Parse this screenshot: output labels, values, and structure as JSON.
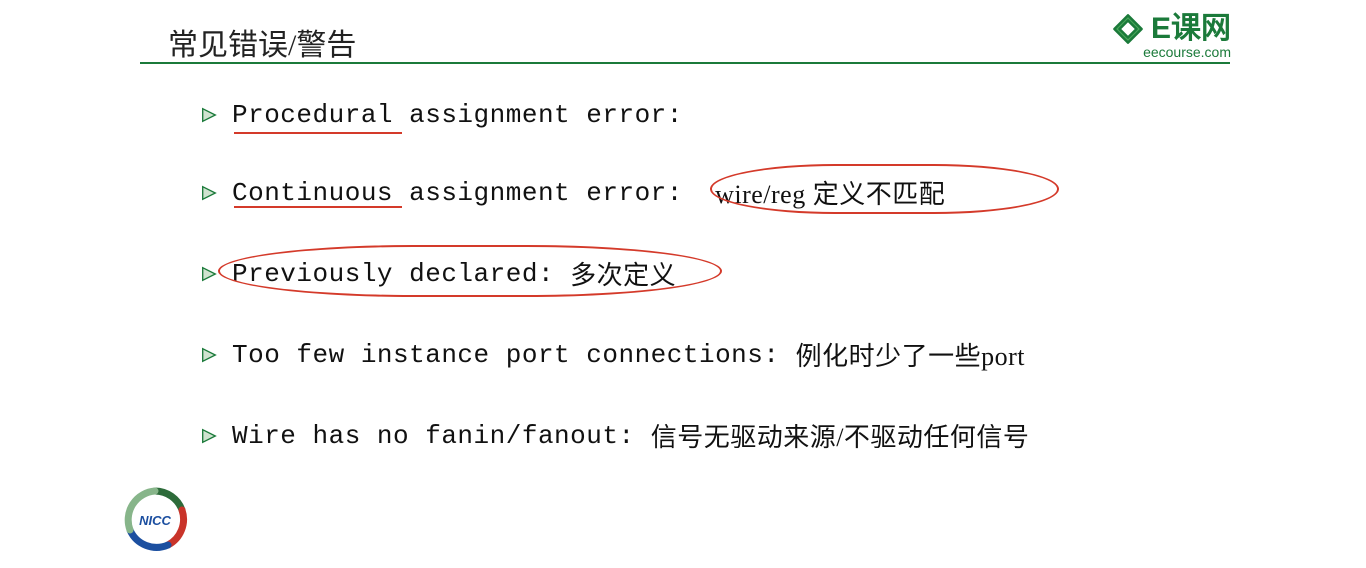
{
  "header": {
    "title": "常见错误/警告",
    "logo_text": "E课网",
    "logo_sub": "eecourse.com"
  },
  "bullets": {
    "b1_en": "Procedural assignment error:",
    "b2_en": "Continuous assignment error:",
    "b2_note": "wire/reg 定义不匹配",
    "b3_en": "Previously declared:",
    "b3_note": "多次定义",
    "b4_en": "Too few instance port connections:",
    "b4_note": "例化时少了一些port",
    "b5_en": "Wire has no fanin/fanout:",
    "b5_note": "信号无驱动来源/不驱动任何信号"
  },
  "badge": {
    "text": "NICC"
  }
}
